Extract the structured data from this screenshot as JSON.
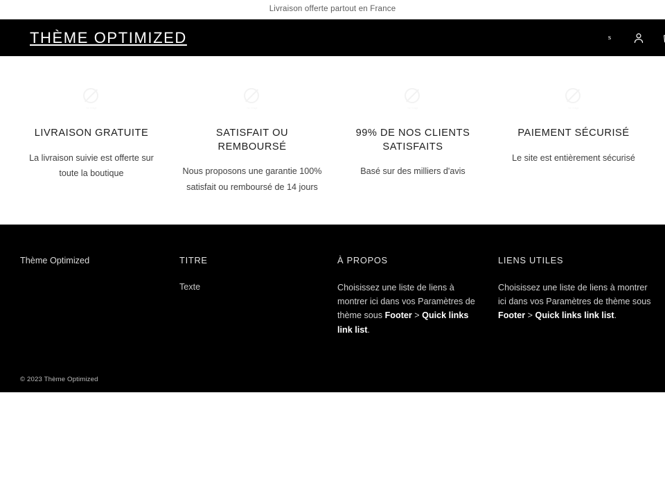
{
  "announcement": {
    "text": "Livraison offerte partout en France"
  },
  "header": {
    "logo": "THÈME OPTIMIZED",
    "icons": {
      "search": {
        "name": "search-icon",
        "glyph": "s"
      },
      "account": {
        "name": "account-icon"
      },
      "cart": {
        "name": "cart-icon"
      }
    }
  },
  "features": [
    {
      "icon": "broken-image-icon",
      "icon_caption": "No image",
      "title": "LIVRAISON GRATUITE",
      "text": "La livraison suivie est offerte sur toute la boutique"
    },
    {
      "icon": "broken-image-icon",
      "icon_caption": "No image",
      "title": "SATISFAIT OU REMBOURSÉ",
      "text": "Nous proposons une garantie 100% satisfait ou remboursé de 14 jours"
    },
    {
      "icon": "broken-image-icon",
      "icon_caption": "No image",
      "title": "99% DE NOS CLIENTS SATISFAITS",
      "text": "Basé sur des milliers d'avis"
    },
    {
      "icon": "broken-image-icon",
      "icon_caption": "No image",
      "title": "PAIEMENT SÉCURISÉ",
      "text": "Le site est entièrement sécurisé"
    }
  ],
  "footer": {
    "brand": "Thème Optimized",
    "col2": {
      "heading": "TITRE",
      "link": "Texte"
    },
    "col3": {
      "heading": "À PROPOS",
      "text_before": "Choisissez une liste de liens à montrer ici dans vos Paramètres de thème sous ",
      "text_bold_1": "Footer",
      "text_sep": " > ",
      "text_bold_2": "Quick links link list",
      "text_after": "."
    },
    "col4": {
      "heading": "LIENS UTILES",
      "text_before": "Choisissez une liste de liens à montrer ici dans vos Paramètres de thème sous ",
      "text_bold_1": "Footer",
      "text_sep": " > ",
      "text_bold_2": "Quick links link list",
      "text_after": "."
    },
    "copyright": "© 2023 Thème Optimized"
  },
  "colors": {
    "header_bg": "#000000",
    "footer_bg": "#000000",
    "page_bg": "#ffffff",
    "announcement_text": "#5b5b5b",
    "feature_title": "#1c1c1c",
    "feature_text": "#404040"
  }
}
